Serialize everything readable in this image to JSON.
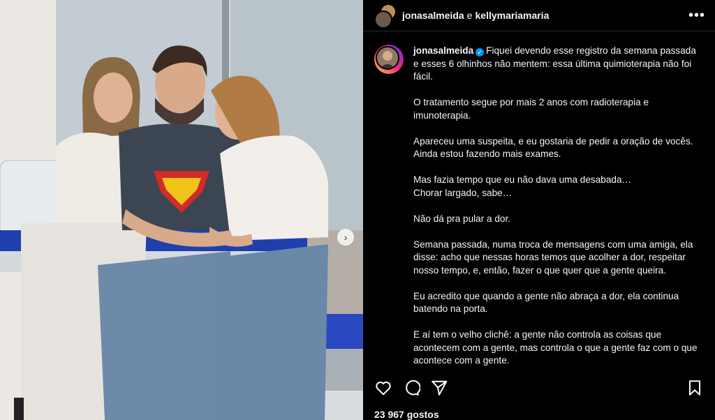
{
  "header": {
    "user1": "jonasalmeida",
    "connector": "e",
    "user2": "kellymariamaria",
    "more_icon": "more-horizontal-icon"
  },
  "caption": {
    "username": "jonasalmeida",
    "verified_icon": "verified-badge-icon",
    "first_paragraph": "Fiquei devendo esse registro da semana passada e esses 6 olhinhos não mentem: essa última quimioterapia não foi fácil.",
    "paragraphs": [
      "O tratamento segue por mais 2 anos com radioterapia e imunoterapia.",
      "Apareceu uma suspeita, e eu gostaria de pedir a oração de vocês. Ainda estou fazendo mais exames.",
      "Mas fazia tempo que eu não dava uma desabada…\nChorar largado, sabe…",
      "Não dá pra pular a dor.",
      "Semana passada, numa troca de mensagens com uma amiga, ela disse: acho que nessas horas temos que acolher a dor, respeitar nosso tempo, e, então, fazer o que quer que a gente queira.",
      "Eu acredito que quando a gente não abraça a dor, ela continua batendo na porta.",
      "E aí tem o velho clichê: a gente não controla as coisas que acontecem com a gente, mas controla o que a gente faz com o que acontece com a gente."
    ]
  },
  "actions": {
    "like_icon": "heart-icon",
    "comment_icon": "comment-icon",
    "share_icon": "send-icon",
    "save_icon": "bookmark-icon"
  },
  "likes": "23 967 gostos",
  "media": {
    "next_icon": "chevron-right-icon"
  },
  "colors": {
    "background": "#000000",
    "text": "#f5f5f5",
    "verified": "#0095f6"
  }
}
